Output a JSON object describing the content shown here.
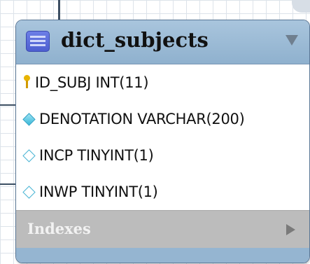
{
  "table": {
    "name": "dict_subjects",
    "icon": "table-icon",
    "collapse_icon": "triangle-down-icon"
  },
  "columns": [
    {
      "name": "ID_SUBJ",
      "type": "INT(11)",
      "icon": "primary-key-icon"
    },
    {
      "name": "DENOTATION",
      "type": "VARCHAR(200)",
      "icon": "not-null-column-icon"
    },
    {
      "name": "INCP",
      "type": "TINYINT(1)",
      "icon": "nullable-column-icon"
    },
    {
      "name": "INWP",
      "type": "TINYINT(1)",
      "icon": "nullable-column-icon"
    }
  ],
  "indexes": {
    "label": "Indexes",
    "icon": "triangle-right-icon"
  },
  "colors": {
    "header": "#9bbbd6",
    "indexes_bar": "#bcbcbc",
    "primary_key": "#e8b400",
    "column_diamond": "#38b8d8"
  }
}
